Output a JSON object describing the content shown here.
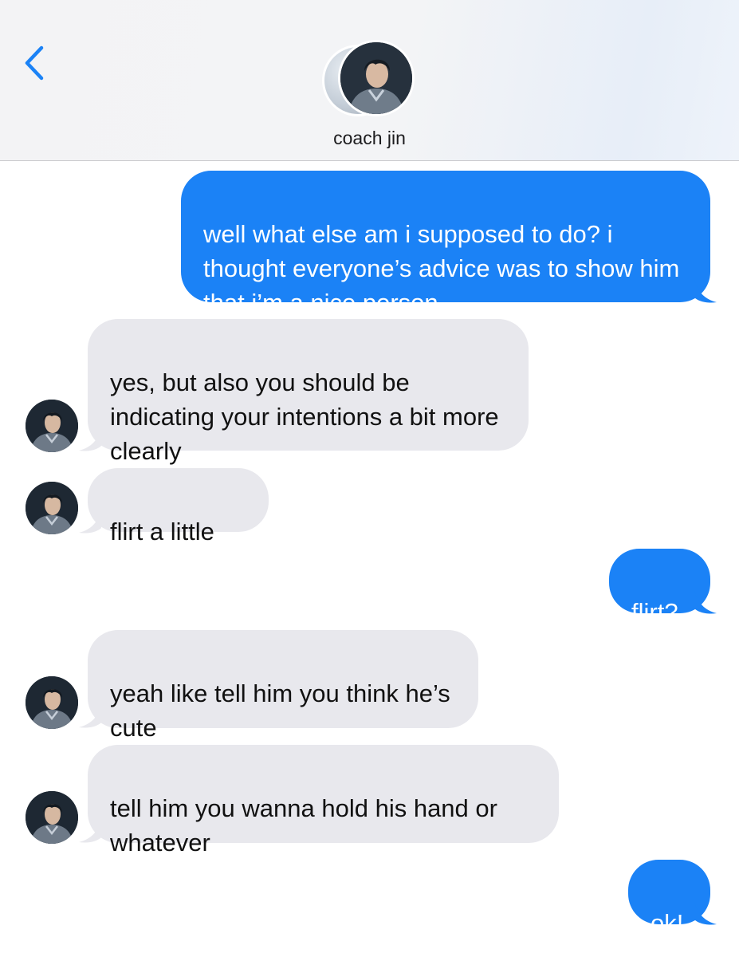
{
  "header": {
    "contact_name": "coach jin",
    "back_icon": "chevron-left-icon",
    "accent_color": "#1b82f6"
  },
  "messages": [
    {
      "from": "me",
      "text": "well what else am i supposed to do? i thought everyone’s advice was to show him that i’m a nice person"
    },
    {
      "from": "them",
      "text": "yes, but also you should be indicating your intentions a bit more clearly"
    },
    {
      "from": "them",
      "text": "flirt a little"
    },
    {
      "from": "me",
      "text": "flirt?"
    },
    {
      "from": "them",
      "text": "yeah like tell him you think he’s cute"
    },
    {
      "from": "them",
      "text": "tell him you wanna hold his hand or whatever"
    },
    {
      "from": "me",
      "text": "ok!"
    }
  ],
  "colors": {
    "sent_bubble": "#1b82f6",
    "received_bubble": "#e8e8ed"
  }
}
